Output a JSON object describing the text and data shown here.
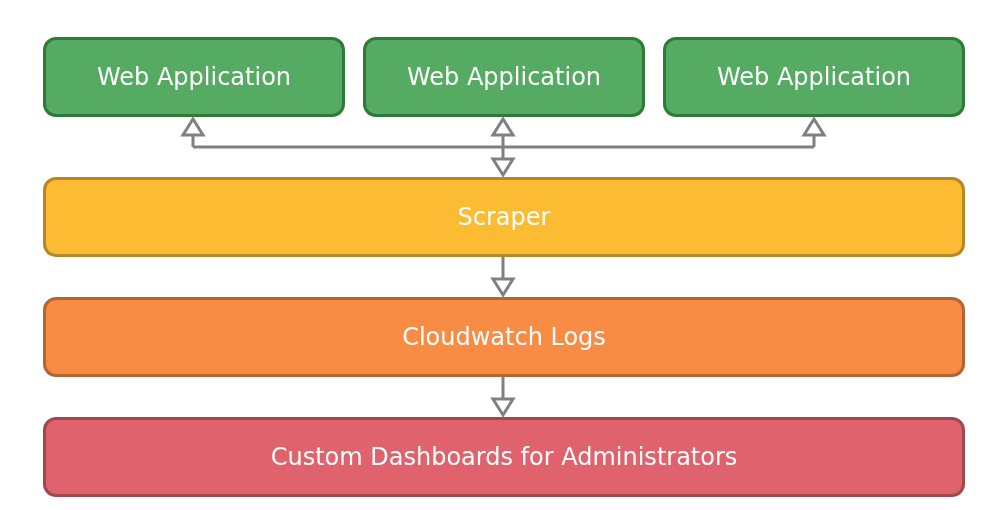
{
  "web_applications": [
    {
      "label": "Web Application"
    },
    {
      "label": "Web Application"
    },
    {
      "label": "Web Application"
    }
  ],
  "layers": [
    {
      "label": "Scraper",
      "color": "#fbbc33"
    },
    {
      "label": "Cloudwatch Logs",
      "color": "#f98c45"
    },
    {
      "label": "Custom Dashboards for Administrators",
      "color": "#e0626c"
    }
  ]
}
